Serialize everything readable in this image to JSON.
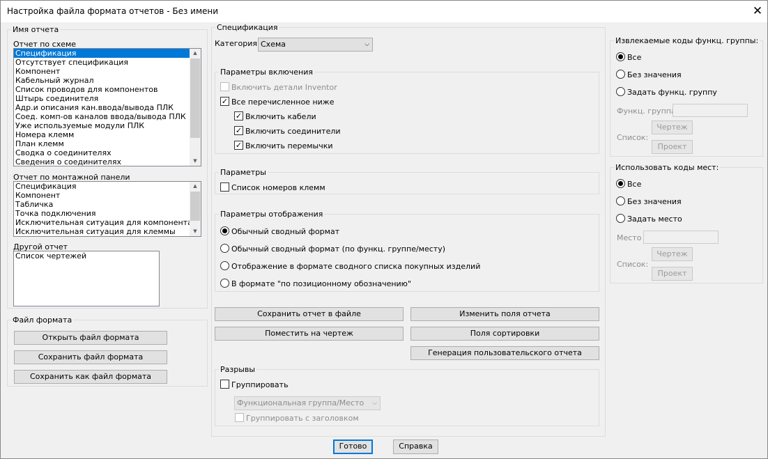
{
  "window": {
    "title": "Настройка файла формата отчетов - Без имени",
    "close": "✕"
  },
  "report_name": {
    "legend": "Имя отчета",
    "schematic": {
      "label": "Отчет по схеме",
      "items": [
        "Спецификация",
        "Отсутствует спецификация",
        "Компонент",
        "Кабельный журнал",
        "Список проводов для компонентов",
        "Штырь соединителя",
        "Адр.и описания кан.ввода/вывода ПЛК",
        "Соед. комп-ов каналов ввода/вывода ПЛК",
        "Уже используемые модули ПЛК",
        "Номера клемм",
        "План клемм",
        "Сводка о соединителях",
        "Сведения о соединителях"
      ],
      "selected": "Спецификация"
    },
    "panel": {
      "label": "Отчет по монтажной панели",
      "items": [
        "Спецификация",
        "Компонент",
        "Табличка",
        "Точка подключения",
        "Исключительная ситуация для компонента",
        "Исключительная ситуация для клеммы"
      ]
    },
    "other": {
      "label": "Другой отчет",
      "items": [
        "Список чертежей"
      ]
    }
  },
  "format_file": {
    "legend": "Файл формата",
    "open_button": "Открыть файл формата",
    "save_button": "Сохранить файл формата",
    "save_as_button": "Сохранить как файл формата"
  },
  "spec": {
    "legend": "Спецификация",
    "category_label": "Категория:",
    "category_value": "Схема",
    "inclusion": {
      "legend": "Параметры включения",
      "include_inventor": "Включить детали Inventor",
      "all_below": "Все перечисленное ниже",
      "cables": "Включить кабели",
      "connectors": "Включить соединители",
      "jumpers": "Включить перемычки"
    },
    "params": {
      "legend": "Параметры",
      "terminal_list": "Список номеров клемм"
    },
    "display": {
      "legend": "Параметры отображения",
      "options": [
        "Обычный сводный формат",
        "Обычный сводный формат (по функц. группе/месту)",
        "Отображение в формате сводного списка покупных изделий",
        "В формате \"по позиционному обозначению\""
      ]
    },
    "buttons": {
      "save_report": "Сохранить отчет в файле",
      "place_on_drawing": "Поместить на чертеж",
      "change_fields": "Изменить поля отчета",
      "sort_fields": "Поля сортировки",
      "user_report": "Генерация пользовательского отчета"
    },
    "breaks": {
      "legend": "Разрывы",
      "group": "Группировать",
      "group_combo": "Функциональная группа/Место",
      "group_header": "Группировать с заголовком"
    }
  },
  "func_codes": {
    "legend": "Извлекаемые коды функц. группы:",
    "options": [
      "Все",
      "Без значения",
      "Задать функц. группу"
    ],
    "field_label": "Функц. группа",
    "drawing_button": "Чертеж",
    "list_label": "Список:",
    "project_button": "Проект"
  },
  "loc_codes": {
    "legend": "Использовать коды мест:",
    "options": [
      "Все",
      "Без значения",
      "Задать место"
    ],
    "field_label": "Место",
    "drawing_button": "Чертеж",
    "list_label": "Список:",
    "project_button": "Проект"
  },
  "footer": {
    "ok": "Готово",
    "help": "Справка"
  }
}
